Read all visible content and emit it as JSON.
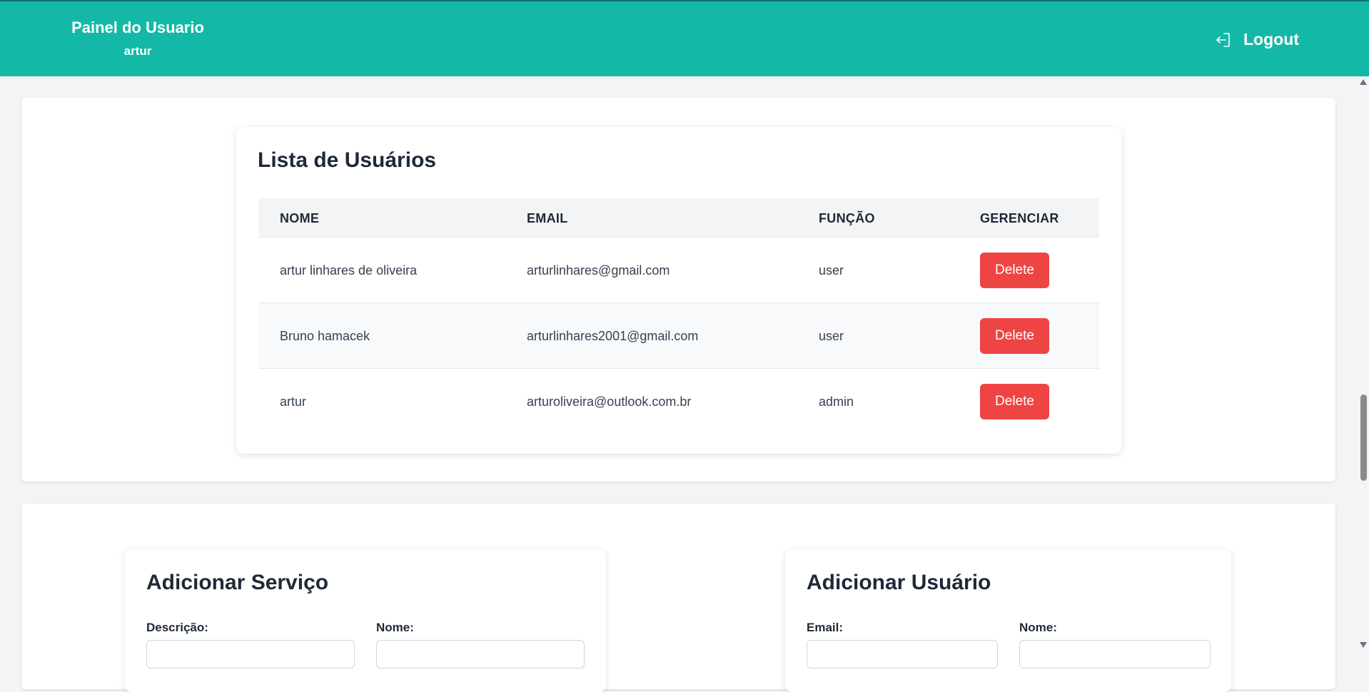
{
  "header": {
    "title": "Painel do Usuario",
    "username": "artur",
    "logout_label": "Logout"
  },
  "users_list": {
    "title": "Lista de Usuários",
    "columns": [
      "NOME",
      "EMAIL",
      "FUNÇÃO",
      "GERENCIAR"
    ],
    "rows": [
      {
        "nome": "artur linhares de oliveira",
        "email": "arturlinhares@gmail.com",
        "funcao": "user",
        "action": "Delete"
      },
      {
        "nome": "Bruno hamacek",
        "email": "arturlinhares2001@gmail.com",
        "funcao": "user",
        "action": "Delete"
      },
      {
        "nome": "artur",
        "email": "arturoliveira@outlook.com.br",
        "funcao": "admin",
        "action": "Delete"
      }
    ]
  },
  "add_service": {
    "title": "Adicionar Serviço",
    "fields": [
      {
        "label": "Descrição:",
        "value": ""
      },
      {
        "label": "Nome:",
        "value": ""
      }
    ]
  },
  "add_user": {
    "title": "Adicionar Usuário",
    "fields": [
      {
        "label": "Email:",
        "value": ""
      },
      {
        "label": "Nome:",
        "value": ""
      }
    ]
  },
  "colors": {
    "header_bg": "#14b8a6",
    "delete_button": "#ef4444",
    "page_bg": "#f3f4f6"
  },
  "icons": {
    "logout": "logout-icon"
  }
}
